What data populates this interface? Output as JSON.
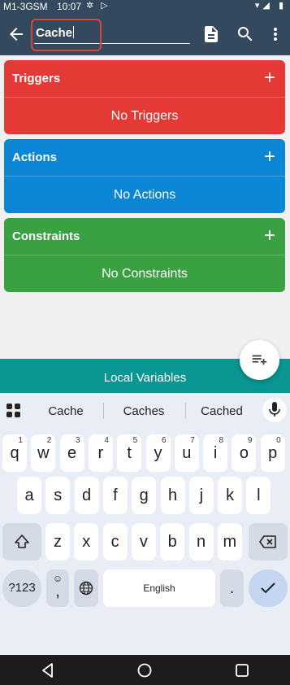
{
  "status": {
    "carrier": "M1-3GSM",
    "time": "10:07"
  },
  "appbar": {
    "macro_name": "Cache"
  },
  "cards": [
    {
      "label": "Triggers",
      "empty_text": "No Triggers",
      "color": "#e53935"
    },
    {
      "label": "Actions",
      "empty_text": "No Actions",
      "color": "#0a86d5"
    },
    {
      "label": "Constraints",
      "empty_text": "No Constraints",
      "color": "#3aa143"
    }
  ],
  "local_variables": {
    "label": "Local Variables",
    "color": "#0a9692"
  },
  "keyboard": {
    "suggestions": [
      "Cache",
      "Caches",
      "Cached"
    ],
    "row1": [
      {
        "k": "q",
        "s": "1"
      },
      {
        "k": "w",
        "s": "2"
      },
      {
        "k": "e",
        "s": "3"
      },
      {
        "k": "r",
        "s": "4"
      },
      {
        "k": "t",
        "s": "5"
      },
      {
        "k": "y",
        "s": "6"
      },
      {
        "k": "u",
        "s": "7"
      },
      {
        "k": "i",
        "s": "8"
      },
      {
        "k": "o",
        "s": "9"
      },
      {
        "k": "p",
        "s": "0"
      }
    ],
    "row2": [
      "a",
      "s",
      "d",
      "f",
      "g",
      "h",
      "j",
      "k",
      "l"
    ],
    "row3": [
      "z",
      "x",
      "c",
      "v",
      "b",
      "n",
      "m"
    ],
    "sym_label": "?123",
    "emoji_label": "☺",
    "comma_label": ",",
    "space_label": "English",
    "period_label": "."
  }
}
